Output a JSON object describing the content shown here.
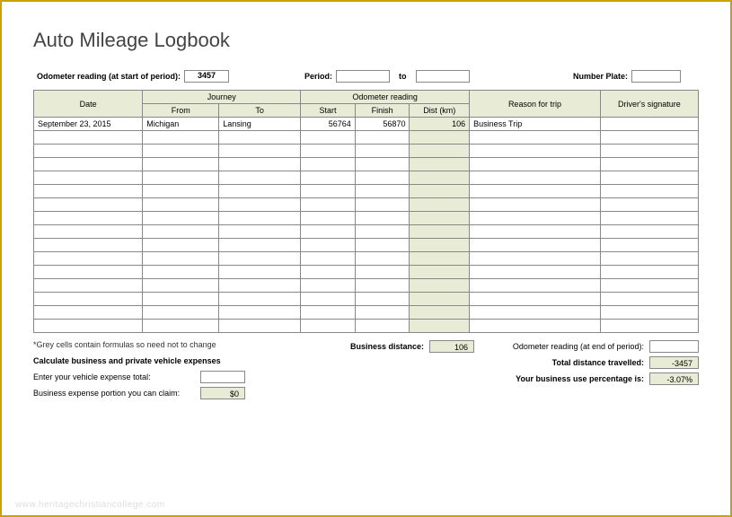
{
  "title": "Auto Mileage Logbook",
  "header": {
    "odometer_start_label": "Odometer reading (at start of period):",
    "odometer_start_value": "3457",
    "period_label": "Period:",
    "period_from": "",
    "period_to_label": "to",
    "period_to": "",
    "number_plate_label": "Number Plate:",
    "number_plate_value": ""
  },
  "columns": {
    "date": "Date",
    "journey": "Journey",
    "from": "From",
    "to": "To",
    "odo": "Odometer reading",
    "start": "Start",
    "finish": "Finish",
    "dist": "Dist (km)",
    "reason": "Reason for trip",
    "signature": "Driver's signature"
  },
  "rows": [
    {
      "date": "September 23, 2015",
      "from": "Michigan",
      "to": "Lansing",
      "start": "56764",
      "finish": "56870",
      "dist": "106",
      "reason": "Business Trip",
      "sig": ""
    },
    {
      "date": "",
      "from": "",
      "to": "",
      "start": "",
      "finish": "",
      "dist": "",
      "reason": "",
      "sig": ""
    },
    {
      "date": "",
      "from": "",
      "to": "",
      "start": "",
      "finish": "",
      "dist": "",
      "reason": "",
      "sig": ""
    },
    {
      "date": "",
      "from": "",
      "to": "",
      "start": "",
      "finish": "",
      "dist": "",
      "reason": "",
      "sig": ""
    },
    {
      "date": "",
      "from": "",
      "to": "",
      "start": "",
      "finish": "",
      "dist": "",
      "reason": "",
      "sig": ""
    },
    {
      "date": "",
      "from": "",
      "to": "",
      "start": "",
      "finish": "",
      "dist": "",
      "reason": "",
      "sig": ""
    },
    {
      "date": "",
      "from": "",
      "to": "",
      "start": "",
      "finish": "",
      "dist": "",
      "reason": "",
      "sig": ""
    },
    {
      "date": "",
      "from": "",
      "to": "",
      "start": "",
      "finish": "",
      "dist": "",
      "reason": "",
      "sig": ""
    },
    {
      "date": "",
      "from": "",
      "to": "",
      "start": "",
      "finish": "",
      "dist": "",
      "reason": "",
      "sig": ""
    },
    {
      "date": "",
      "from": "",
      "to": "",
      "start": "",
      "finish": "",
      "dist": "",
      "reason": "",
      "sig": ""
    },
    {
      "date": "",
      "from": "",
      "to": "",
      "start": "",
      "finish": "",
      "dist": "",
      "reason": "",
      "sig": ""
    },
    {
      "date": "",
      "from": "",
      "to": "",
      "start": "",
      "finish": "",
      "dist": "",
      "reason": "",
      "sig": ""
    },
    {
      "date": "",
      "from": "",
      "to": "",
      "start": "",
      "finish": "",
      "dist": "",
      "reason": "",
      "sig": ""
    },
    {
      "date": "",
      "from": "",
      "to": "",
      "start": "",
      "finish": "",
      "dist": "",
      "reason": "",
      "sig": ""
    },
    {
      "date": "",
      "from": "",
      "to": "",
      "start": "",
      "finish": "",
      "dist": "",
      "reason": "",
      "sig": ""
    },
    {
      "date": "",
      "from": "",
      "to": "",
      "start": "",
      "finish": "",
      "dist": "",
      "reason": "",
      "sig": ""
    }
  ],
  "footer": {
    "note": "*Grey cells contain formulas so need not to change",
    "subhead": "Calculate business and private vehicle expenses",
    "expense_label": "Enter your vehicle expense total:",
    "expense_value": "",
    "claim_label": "Business expense portion you can claim:",
    "claim_value": "$0",
    "bus_dist_label": "Business distance:",
    "bus_dist_value": "106",
    "odo_end_label": "Odometer reading (at end of period):",
    "odo_end_value": "",
    "total_dist_label": "Total distance travelled:",
    "total_dist_value": "-3457",
    "pct_label": "Your business use percentage is:",
    "pct_value": "-3.07%"
  },
  "watermark": "www.heritagechristiancollege.com"
}
